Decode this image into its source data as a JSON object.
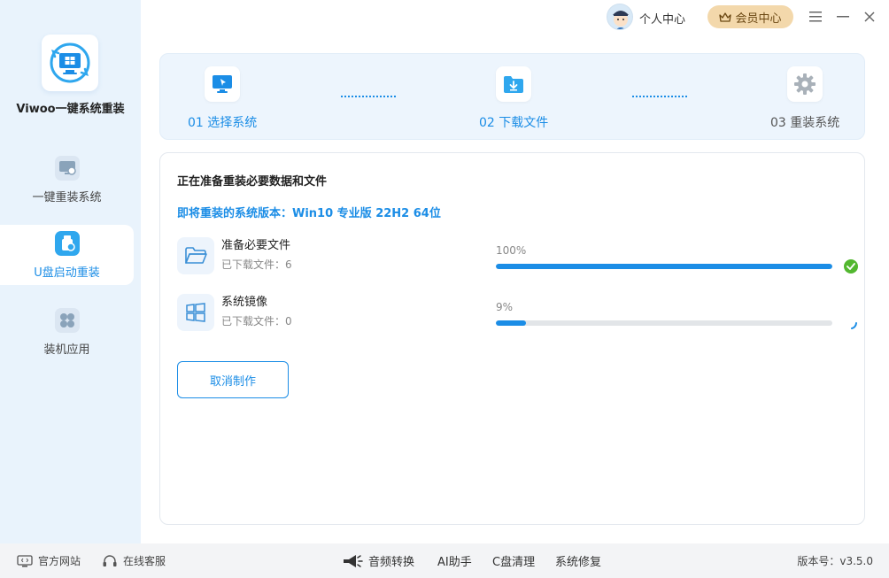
{
  "app": {
    "name": "Viwoo一键系统重装"
  },
  "sidebar": {
    "items": [
      {
        "label": "一键重装系统",
        "icon": "monitor-refresh-icon",
        "active": false
      },
      {
        "label": "U盘启动重装",
        "icon": "usb-drive-icon",
        "active": true
      },
      {
        "label": "装机应用",
        "icon": "apps-grid-icon",
        "active": false
      }
    ]
  },
  "topbar": {
    "personal_center": "个人中心",
    "vip_center": "会员中心"
  },
  "steps": [
    {
      "label": "01 选择系统",
      "icon": "monitor-cursor-icon",
      "state": "done"
    },
    {
      "label": "02 下载文件",
      "icon": "folder-download-icon",
      "state": "done"
    },
    {
      "label": "03 重装系统",
      "icon": "gear-icon",
      "state": "todo"
    }
  ],
  "main": {
    "title": "正在准备重装必要数据和文件",
    "system_version": "即将重装的系统版本：Win10 专业版 22H2 64位",
    "tasks": [
      {
        "name": "准备必要文件",
        "count_text": "已下载文件：6",
        "percent_text": "100%",
        "progress": 1.0,
        "status": "done",
        "icon": "folder-icon"
      },
      {
        "name": "系统镜像",
        "count_text": "已下载文件：0",
        "percent_text": "9%",
        "progress": 0.09,
        "status": "loading",
        "icon": "windows-icon"
      }
    ],
    "cancel_label": "取消制作"
  },
  "footer": {
    "official_site": "官方网站",
    "online_service": "在线客服",
    "audio_convert": "音频转换",
    "ai_assistant": "AI助手",
    "c_clean": "C盘清理",
    "sys_repair": "系统修复",
    "version": "版本号：v3.5.0"
  },
  "colors": {
    "accent": "#1b8de6",
    "sidebar_bg": "#e9f3fc",
    "success": "#52b72f",
    "vip_bg": "#f3d8ab"
  }
}
